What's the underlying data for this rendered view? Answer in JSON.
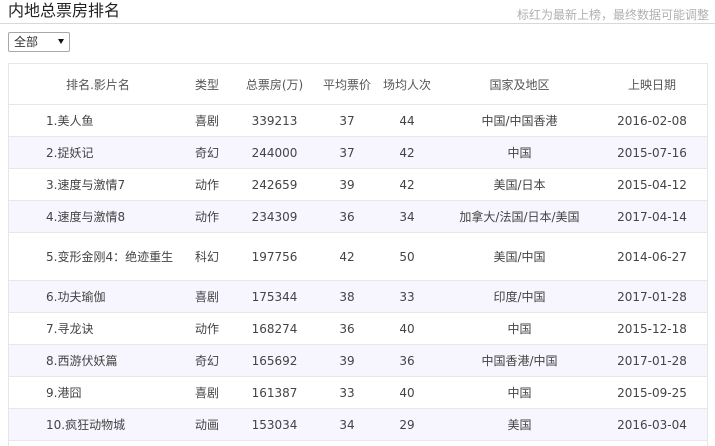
{
  "header": {
    "title": "内地总票房排名",
    "note": "标红为最新上榜，最终数据可能调整"
  },
  "filter": {
    "selected": "全部"
  },
  "table": {
    "columns": [
      "排名.影片名",
      "类型",
      "总票房(万)",
      "平均票价",
      "场均人次",
      "国家及地区",
      "上映日期"
    ],
    "rows": [
      {
        "name": "1.美人鱼",
        "type": "喜剧",
        "box": "339213",
        "price": "37",
        "attendance": "44",
        "region": "中国/中国香港",
        "date": "2016-02-08"
      },
      {
        "name": "2.捉妖记",
        "type": "奇幻",
        "box": "244000",
        "price": "37",
        "attendance": "42",
        "region": "中国",
        "date": "2015-07-16"
      },
      {
        "name": "3.速度与激情7",
        "type": "动作",
        "box": "242659",
        "price": "39",
        "attendance": "42",
        "region": "美国/日本",
        "date": "2015-04-12"
      },
      {
        "name": "4.速度与激情8",
        "type": "动作",
        "box": "234309",
        "price": "36",
        "attendance": "34",
        "region": "加拿大/法国/日本/美国",
        "date": "2017-04-14"
      },
      {
        "name": "5.变形金刚4：绝迹重生",
        "type": "科幻",
        "box": "197756",
        "price": "42",
        "attendance": "50",
        "region": "美国/中国",
        "date": "2014-06-27"
      },
      {
        "name": "6.功夫瑜伽",
        "type": "喜剧",
        "box": "175344",
        "price": "38",
        "attendance": "33",
        "region": "印度/中国",
        "date": "2017-01-28"
      },
      {
        "name": "7.寻龙诀",
        "type": "动作",
        "box": "168274",
        "price": "36",
        "attendance": "40",
        "region": "中国",
        "date": "2015-12-18"
      },
      {
        "name": "8.西游伏妖篇",
        "type": "奇幻",
        "box": "165692",
        "price": "39",
        "attendance": "36",
        "region": "中国香港/中国",
        "date": "2017-01-28"
      },
      {
        "name": "9.港囧",
        "type": "喜剧",
        "box": "161387",
        "price": "33",
        "attendance": "40",
        "region": "中国",
        "date": "2015-09-25"
      },
      {
        "name": "10.疯狂动物城",
        "type": "动画",
        "box": "153034",
        "price": "34",
        "attendance": "29",
        "region": "美国",
        "date": "2016-03-04"
      }
    ]
  }
}
